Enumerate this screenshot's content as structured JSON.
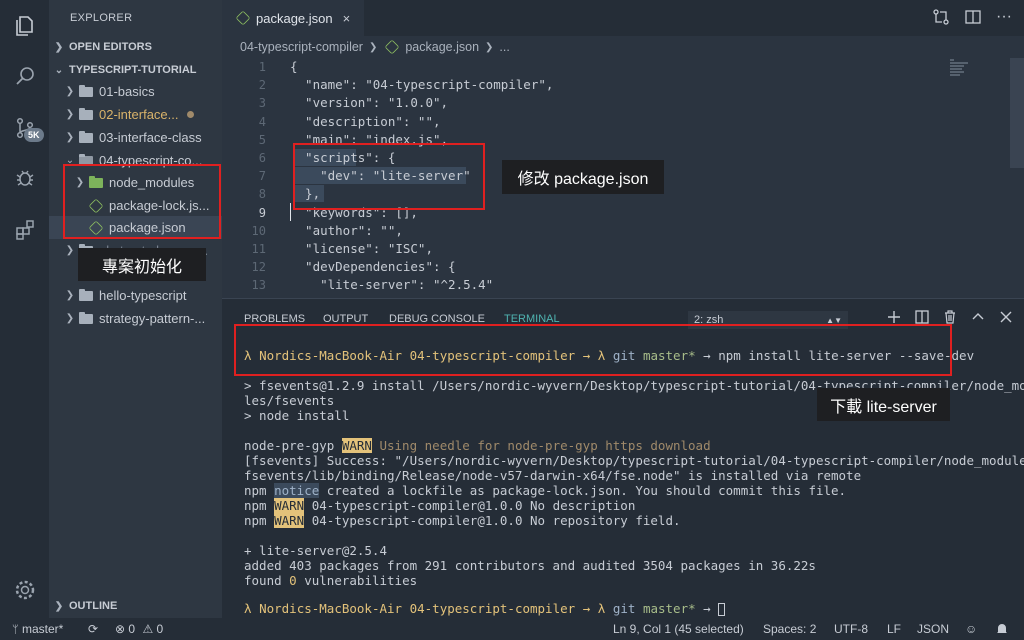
{
  "activity_bar": {
    "icons": [
      "files-icon",
      "search-icon",
      "source-control-icon",
      "debug-icon",
      "extensions-icon",
      "gear-icon"
    ],
    "scm_badge": "5K"
  },
  "sidebar": {
    "title": "EXPLORER",
    "open_editors": "OPEN EDITORS",
    "workspace": "TYPESCRIPT-TUTORIAL",
    "items": [
      {
        "label": "01-basics"
      },
      {
        "label": "02-interface..."
      },
      {
        "label": "03-interface-class"
      },
      {
        "label": "04-typescript-co..."
      },
      {
        "label": "node_modules"
      },
      {
        "label": "package-lock.js..."
      },
      {
        "label": "package.json"
      },
      {
        "label": "abstract-class-ex..."
      },
      {
        "label": "hello-typescript"
      },
      {
        "label": "strategy-pattern-..."
      }
    ],
    "outline": "OUTLINE"
  },
  "editor": {
    "tab_label": "package.json",
    "tab_close": "×",
    "breadcrumb": [
      "04-typescript-compiler",
      "package.json",
      "..."
    ],
    "line_numbers": [
      "1",
      "2",
      "3",
      "4",
      "5",
      "6",
      "7",
      "8",
      "9",
      "10",
      "11",
      "12",
      "13"
    ],
    "lines": [
      "{",
      "  \"name\": \"04-typescript-compiler\",",
      "  \"version\": \"1.0.0\",",
      "  \"description\": \"\",",
      "  \"main\": \"index.js\",",
      "  \"scripts\": {",
      "    \"dev\": \"lite-server\"",
      "  },",
      "  \"keywords\": [],",
      "  \"author\": \"\",",
      "  \"license\": \"ISC\",",
      "  \"devDependencies\": {",
      "    \"lite-server\": \"^2.5.4\""
    ]
  },
  "panel": {
    "tabs": [
      "PROBLEMS",
      "OUTPUT",
      "DEBUG CONSOLE",
      "TERMINAL"
    ],
    "active_tab": "TERMINAL",
    "shell": "2: zsh",
    "terminal": {
      "prompt1": {
        "lambda": "λ",
        "host": "Nordics-MacBook-Air",
        "dir": "04-typescript-compiler",
        "arrow": "→",
        "lambda2": "λ",
        "git": "git",
        "branch": "master*",
        "arrow2": "→",
        "cmd": "npm install lite-server --save-dev"
      },
      "out1": "> fsevents@1.2.9 install /Users/nordic-wyvern/Desktop/typescript-tutorial/04-typescript-compiler/node_modu",
      "out2": "les/fsevents",
      "out3": "> node install",
      "gyp_prefix": "node-pre-gyp",
      "gyp_warn": "WARN",
      "gyp_msg": "Using needle for node-pre-gyp https download",
      "fse1": "[fsevents] Success: \"/Users/nordic-wyvern/Desktop/typescript-tutorial/04-typescript-compiler/node_modules/",
      "fse2": "fsevents/lib/binding/Release/node-v57-darwin-x64/fse.node\" is installed via remote",
      "npm": "npm",
      "notice": "notice",
      "notice_msg": "created a lockfile as package-lock.json. You should commit this file.",
      "warn": "WARN",
      "warn1_msg": "04-typescript-compiler@1.0.0 No description",
      "warn2_msg": "04-typescript-compiler@1.0.0 No repository field.",
      "added1": "+ lite-server@2.5.4",
      "added2": "added 403 packages from 291 contributors and audited 3504 packages in 36.22s",
      "found_pre": "found",
      "found_num": "0",
      "found_post": "vulnerabilities",
      "prompt2": {
        "lambda": "λ",
        "host": "Nordics-MacBook-Air",
        "dir": "04-typescript-compiler",
        "arrow": "→",
        "lambda2": "λ",
        "git": "git",
        "branch": "master*",
        "arrow2": "→"
      }
    }
  },
  "status_bar": {
    "branch": "master*",
    "errors": "0",
    "warnings": "0",
    "cursor": "Ln 9, Col 1 (45 selected)",
    "spaces": "Spaces: 2",
    "encoding": "UTF-8",
    "eol": "LF",
    "language": "JSON"
  },
  "annotations": {
    "callout_scripts": "修改 package.json",
    "callout_project": "專案初始化",
    "callout_install": "下載 lite-server"
  },
  "colors": {
    "background": "#2b3440",
    "accent_terminal": "#4fb3b0",
    "annotation_red": "#e02020"
  }
}
